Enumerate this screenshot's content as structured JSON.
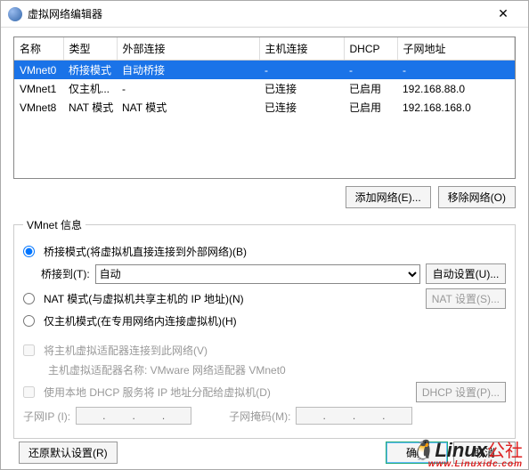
{
  "window": {
    "title": "虚拟网络编辑器"
  },
  "table": {
    "headers": [
      "名称",
      "类型",
      "外部连接",
      "主机连接",
      "DHCP",
      "子网地址"
    ],
    "rows": [
      {
        "name": "VMnet0",
        "type": "桥接模式",
        "ext": "自动桥接",
        "host": "-",
        "dhcp": "-",
        "subnet": "-",
        "selected": true
      },
      {
        "name": "VMnet1",
        "type": "仅主机...",
        "ext": "-",
        "host": "已连接",
        "dhcp": "已启用",
        "subnet": "192.168.88.0",
        "selected": false
      },
      {
        "name": "VMnet8",
        "type": "NAT 模式",
        "ext": "NAT 模式",
        "host": "已连接",
        "dhcp": "已启用",
        "subnet": "192.168.168.0",
        "selected": false
      }
    ]
  },
  "buttons": {
    "add_network": "添加网络(E)...",
    "remove_network": "移除网络(O)"
  },
  "info": {
    "legend": "VMnet 信息",
    "radio_bridge": "桥接模式(将虚拟机直接连接到外部网络)(B)",
    "bridge_to_label": "桥接到(T):",
    "bridge_to_value": "自动",
    "auto_settings": "自动设置(U)...",
    "radio_nat": "NAT 模式(与虚拟机共享主机的 IP 地址)(N)",
    "nat_settings": "NAT 设置(S)...",
    "radio_hostonly": "仅主机模式(在专用网络内连接虚拟机)(H)",
    "chk_connect_host": "将主机虚拟适配器连接到此网络(V)",
    "host_adapter_label": "主机虚拟适配器名称: VMware 网络适配器 VMnet0",
    "chk_dhcp": "使用本地 DHCP 服务将 IP 地址分配给虚拟机(D)",
    "dhcp_settings": "DHCP 设置(P)...",
    "subnet_ip_label": "子网IP (I):",
    "subnet_mask_label": "子网掩码(M):"
  },
  "footer": {
    "restore": "还原默认设置(R)",
    "ok": "确定",
    "cancel": "取消"
  },
  "watermark": {
    "brand": "Linux",
    "suffix": "公社",
    "url": "www.Linuxidc.com"
  }
}
